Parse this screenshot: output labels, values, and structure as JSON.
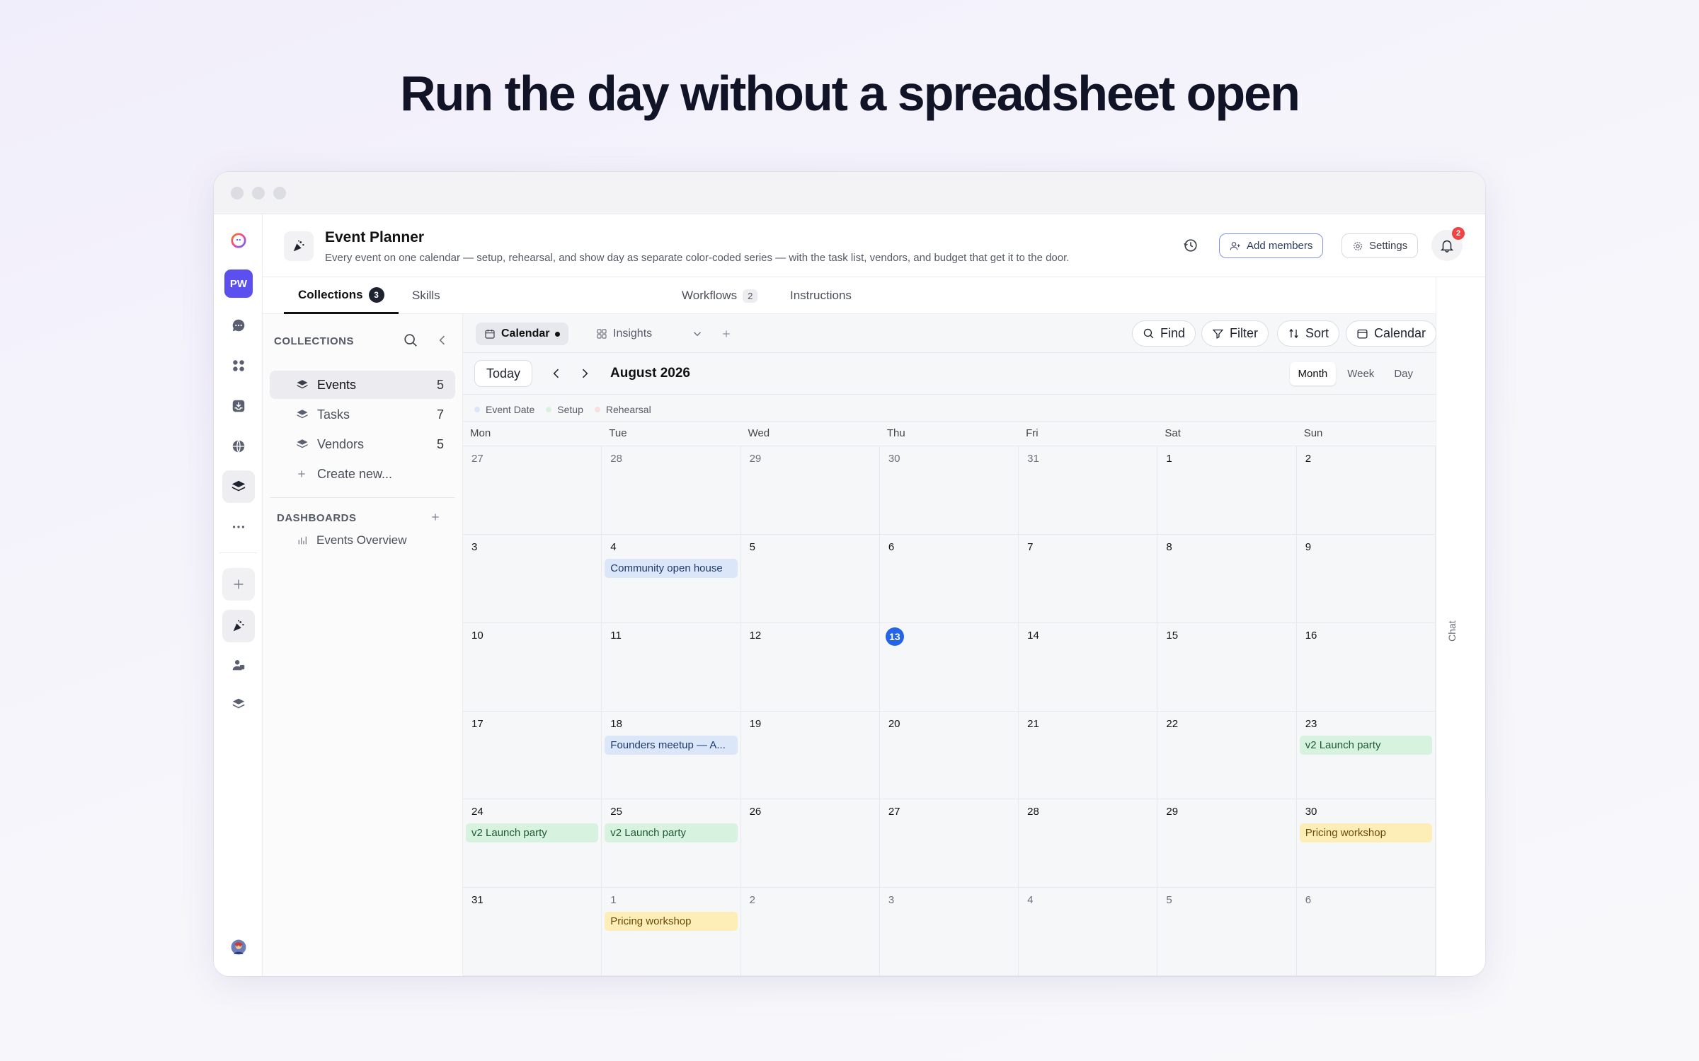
{
  "headline": "Run the day without a spreadsheet open",
  "app": {
    "title": "Event Planner",
    "description": "Every event on one calendar — setup, rehearsal, and show day as separate color-coded series — with the task list, vendors, and budget that get it to the door.",
    "avatar_initials": "PW",
    "add_members_label": "Add members",
    "settings_label": "Settings",
    "notification_count": "2"
  },
  "tabs": [
    {
      "label": "Collections",
      "count": "3"
    },
    {
      "label": "Skills"
    },
    {
      "label": "Workflows",
      "count": "2"
    },
    {
      "label": "Instructions"
    }
  ],
  "chat_label": "Chat",
  "sidebar": {
    "collections_heading": "COLLECTIONS",
    "items": [
      {
        "label": "Events",
        "count": "5"
      },
      {
        "label": "Tasks",
        "count": "7"
      },
      {
        "label": "Vendors",
        "count": "5"
      }
    ],
    "create_new": "Create new...",
    "dashboards_heading": "DASHBOARDS",
    "dashboards": [
      {
        "label": "Events Overview"
      }
    ]
  },
  "views": {
    "calendar_tab": "Calendar",
    "insights_tab": "Insights",
    "find": "Find",
    "filter": "Filter",
    "sort": "Sort",
    "calendar_btn": "Calendar"
  },
  "calendar": {
    "today_label": "Today",
    "month_label": "August 2026",
    "modes": [
      "Month",
      "Week",
      "Day"
    ],
    "active_mode": "Month",
    "legend": [
      {
        "label": "Event Date",
        "color": "#dbe6f9"
      },
      {
        "label": "Setup",
        "color": "#d7f3df"
      },
      {
        "label": "Rehearsal",
        "color": "#fbdede"
      }
    ],
    "weekdays": [
      "Mon",
      "Tue",
      "Wed",
      "Thu",
      "Fri",
      "Sat",
      "Sun"
    ],
    "days": [
      {
        "d": "27",
        "other": true
      },
      {
        "d": "28",
        "other": true
      },
      {
        "d": "29",
        "other": true
      },
      {
        "d": "30",
        "other": true
      },
      {
        "d": "31",
        "other": true
      },
      {
        "d": "1"
      },
      {
        "d": "2"
      },
      {
        "d": "3"
      },
      {
        "d": "4",
        "event": {
          "label": "Community open house",
          "color": "blue"
        }
      },
      {
        "d": "5"
      },
      {
        "d": "6"
      },
      {
        "d": "7"
      },
      {
        "d": "8"
      },
      {
        "d": "9"
      },
      {
        "d": "10"
      },
      {
        "d": "11"
      },
      {
        "d": "12"
      },
      {
        "d": "13",
        "today": true
      },
      {
        "d": "14"
      },
      {
        "d": "15"
      },
      {
        "d": "16"
      },
      {
        "d": "17"
      },
      {
        "d": "18",
        "event": {
          "label": "Founders meetup — A...",
          "color": "blue"
        }
      },
      {
        "d": "19"
      },
      {
        "d": "20"
      },
      {
        "d": "21"
      },
      {
        "d": "22"
      },
      {
        "d": "23",
        "event": {
          "label": "v2 Launch party",
          "color": "green"
        }
      },
      {
        "d": "24",
        "event": {
          "label": "v2 Launch party",
          "color": "green"
        }
      },
      {
        "d": "25",
        "event": {
          "label": "v2 Launch party",
          "color": "green"
        }
      },
      {
        "d": "26"
      },
      {
        "d": "27"
      },
      {
        "d": "28"
      },
      {
        "d": "29"
      },
      {
        "d": "30",
        "event": {
          "label": "Pricing workshop",
          "color": "yellow"
        }
      },
      {
        "d": "31"
      },
      {
        "d": "1",
        "other": true,
        "event": {
          "label": "Pricing workshop",
          "color": "yellow"
        }
      },
      {
        "d": "2",
        "other": true
      },
      {
        "d": "3",
        "other": true
      },
      {
        "d": "4",
        "other": true
      },
      {
        "d": "5",
        "other": true
      },
      {
        "d": "6",
        "other": true
      }
    ]
  }
}
